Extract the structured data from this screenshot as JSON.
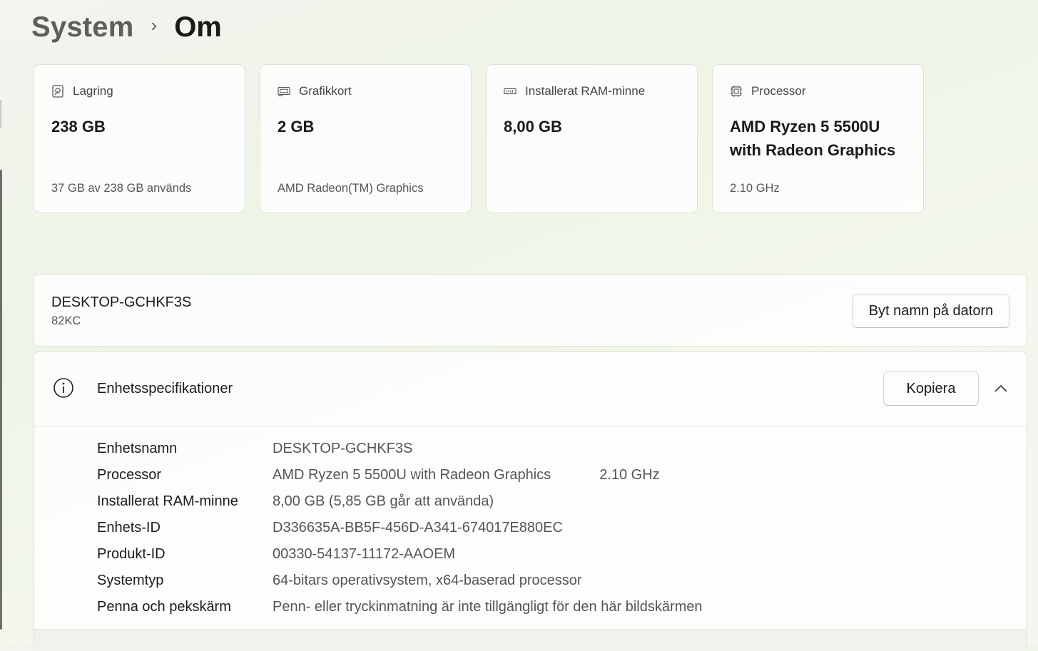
{
  "breadcrumb": {
    "parent": "System",
    "separator": "›",
    "current": "Om"
  },
  "cards": [
    {
      "icon": "storage-icon",
      "label": "Lagring",
      "value": "238 GB",
      "sub": "37 GB av 238 GB används"
    },
    {
      "icon": "graphics-card-icon",
      "label": "Grafikkort",
      "value": "2 GB",
      "sub": "AMD Radeon(TM) Graphics"
    },
    {
      "icon": "ram-icon",
      "label": "Installerat RAM-minne",
      "value": "8,00 GB",
      "sub": ""
    },
    {
      "icon": "processor-icon",
      "label": "Processor",
      "value": "AMD Ryzen 5 5500U with Radeon Graphics",
      "sub": "2.10 GHz"
    }
  ],
  "device": {
    "name": "DESKTOP-GCHKF3S",
    "model": "82KC",
    "rename_button": "Byt namn på datorn"
  },
  "specs": {
    "icon": "info-icon",
    "title": "Enhetsspecifikationer",
    "copy_button": "Kopiera",
    "collapse_icon": "chevron-up-icon",
    "rows": [
      {
        "key": "Enhetsnamn",
        "value": "DESKTOP-GCHKF3S",
        "extra": ""
      },
      {
        "key": "Processor",
        "value": "AMD Ryzen 5 5500U with Radeon Graphics",
        "extra": "2.10 GHz"
      },
      {
        "key": "Installerat RAM-minne",
        "value": "8,00 GB (5,85 GB går att använda)",
        "extra": ""
      },
      {
        "key": "Enhets-ID",
        "value": "D336635A-BB5F-456D-A341-674017E880EC",
        "extra": ""
      },
      {
        "key": "Produkt-ID",
        "value": "00330-54137-11172-AAOEM",
        "extra": ""
      },
      {
        "key": "Systemtyp",
        "value": "64-bitars operativsystem, x64-baserad processor",
        "extra": ""
      },
      {
        "key": "Penna och pekskärm",
        "value": "Penn- eller tryckinmatning är inte tillgängligt för den här bildskärmen",
        "extra": ""
      }
    ]
  }
}
